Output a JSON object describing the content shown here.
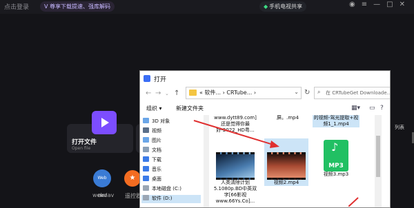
{
  "topbar": {
    "login": "点击登录",
    "vip_banner": "尊享下载提速、强库解码",
    "phone_mirror": "手机电视共享"
  },
  "home": {
    "open_file_title": "打开文件",
    "open_file_sub": "Open file",
    "webdav_label": "webdav",
    "webdav_icon_text": "Web DAV",
    "remote_label": "遥控器",
    "side_tab": "列表"
  },
  "dialog": {
    "title": "打开",
    "path_prefix": "«",
    "path_part1": "软件...",
    "path_part2": "CRTube...",
    "search_placeholder": "在 CRTubeGet Downloade...",
    "organize": "组织 ▾",
    "new_folder": "新建文件夹",
    "tree": [
      {
        "label": "3D 对象",
        "icon_color": "#6aa6e8"
      },
      {
        "label": "视频",
        "icon_color": "#5a6f8a"
      },
      {
        "label": "图片",
        "icon_color": "#6aa6e8"
      },
      {
        "label": "文档",
        "icon_color": "#8aa0b8"
      },
      {
        "label": "下载",
        "icon_color": "#3b7be8"
      },
      {
        "label": "音乐",
        "icon_color": "#3b7be8"
      },
      {
        "label": "桌面",
        "icon_color": "#3b7be8"
      },
      {
        "label": "本地磁盘 (C:)",
        "icon_color": "#9aa6b4"
      },
      {
        "label": "软件 (D:)",
        "icon_color": "#9aa6b4"
      }
    ],
    "files": [
      {
        "name": "www.dytt89.com]还是觉得你最好-2022_HD粤...",
        "type": "video-top"
      },
      {
        "name": "屏。.mp4",
        "type": "video-top"
      },
      {
        "name": "的视频-驾光提取+视频1_1.mp4",
        "type": "video-top-sel"
      },
      {
        "name": "人类清除计划5.1080p.BD中英双字[66影视www.66Ys.Co]...",
        "type": "video-space"
      },
      {
        "name": "视频2.mp4",
        "type": "video-red"
      },
      {
        "name": "视频3.mp3",
        "type": "mp3"
      }
    ],
    "mp3_badge": "MP3"
  },
  "colors": {
    "accent": "#7c4dff",
    "selection": "#cce4f7",
    "arrow": "#e03030"
  }
}
